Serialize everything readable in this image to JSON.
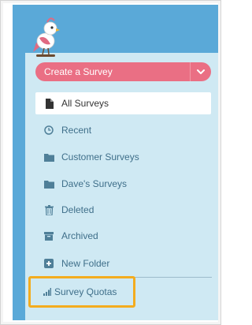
{
  "create_button": {
    "label": "Create a Survey"
  },
  "nav": {
    "items": [
      {
        "label": "All Surveys",
        "icon": "file-icon",
        "active": true
      },
      {
        "label": "Recent",
        "icon": "clock-icon"
      },
      {
        "label": "Customer Surveys",
        "icon": "folder-icon"
      },
      {
        "label": "Dave's Surveys",
        "icon": "folder-icon"
      },
      {
        "label": "Deleted",
        "icon": "trash-icon"
      },
      {
        "label": "Archived",
        "icon": "archive-icon"
      },
      {
        "label": "New Folder",
        "icon": "plus-square-icon"
      }
    ]
  },
  "quotas": {
    "label": "Survey Quotas",
    "icon": "bar-chart-icon"
  },
  "colors": {
    "sidebar": "#5aa9d8",
    "panel": "#cfe9f3",
    "create_button": "#ea6f84",
    "highlight": "#f3ac1f",
    "nav_text": "#3f6f8a"
  }
}
